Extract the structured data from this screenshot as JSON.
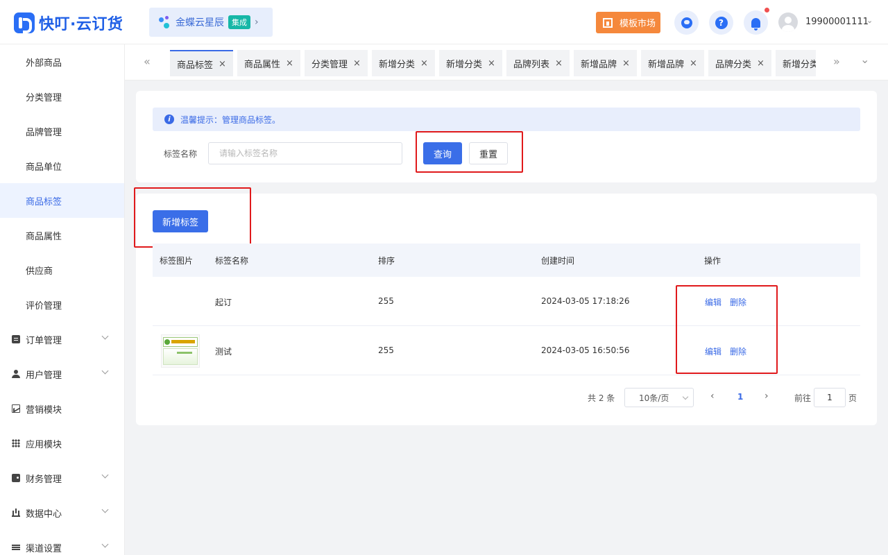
{
  "header": {
    "logo_text": "快叮·云订货",
    "integration": {
      "name": "金蝶云星辰",
      "badge": "集成",
      "arrow": "›"
    },
    "template_market": "模板市场",
    "help_glyph": "?",
    "user_phone": "19900001111",
    "user_caret": "⌄"
  },
  "sidebar": {
    "items": [
      {
        "label": "外部商品",
        "active": false
      },
      {
        "label": "分类管理",
        "active": false
      },
      {
        "label": "品牌管理",
        "active": false
      },
      {
        "label": "商品单位",
        "active": false
      },
      {
        "label": "商品标签",
        "active": true
      },
      {
        "label": "商品属性",
        "active": false
      },
      {
        "label": "供应商",
        "active": false
      },
      {
        "label": "评价管理",
        "active": false
      }
    ],
    "groups": [
      {
        "label": "订单管理",
        "icon": "order-icon",
        "expandable": true
      },
      {
        "label": "用户管理",
        "icon": "user-icon",
        "expandable": true
      },
      {
        "label": "营销模块",
        "icon": "marketing-icon",
        "expandable": false
      },
      {
        "label": "应用模块",
        "icon": "apps-icon",
        "expandable": false
      },
      {
        "label": "财务管理",
        "icon": "wallet-icon",
        "expandable": true
      },
      {
        "label": "数据中心",
        "icon": "bar-chart-icon",
        "expandable": true
      },
      {
        "label": "渠道设置",
        "icon": "list-icon",
        "expandable": true
      }
    ]
  },
  "tabs": {
    "nav_left": "«",
    "nav_right": "»",
    "dropdown": "⌄",
    "close_glyph": "×",
    "items": [
      {
        "label": "商品标签",
        "active": true
      },
      {
        "label": "商品属性",
        "active": false
      },
      {
        "label": "分类管理",
        "active": false
      },
      {
        "label": "新增分类",
        "active": false
      },
      {
        "label": "新增分类",
        "active": false
      },
      {
        "label": "品牌列表",
        "active": false
      },
      {
        "label": "新增品牌",
        "active": false
      },
      {
        "label": "新增品牌",
        "active": false
      },
      {
        "label": "品牌分类",
        "active": false
      },
      {
        "label": "新增分类",
        "active": false
      }
    ]
  },
  "search": {
    "tip_icon": "i",
    "tip": "温馨提示：管理商品标签。",
    "label": "标签名称",
    "placeholder": "请输入标签名称",
    "value": "",
    "query_button": "查询",
    "reset_button": "重置"
  },
  "list": {
    "add_button": "新增标签",
    "columns": [
      "标签图片",
      "标签名称",
      "排序",
      "创建时间",
      "操作"
    ],
    "rows": [
      {
        "has_image": false,
        "name": "起订",
        "sort": "255",
        "created": "2024-03-05 17:18:26",
        "edit": "编辑",
        "delete": "删除"
      },
      {
        "has_image": true,
        "name": "测试",
        "sort": "255",
        "created": "2024-03-05 16:50:56",
        "edit": "编辑",
        "delete": "删除"
      }
    ]
  },
  "pagination": {
    "total": "共 2 条",
    "page_size": "10条/页",
    "prev": "‹",
    "next": "›",
    "current_page": "1",
    "goto_label": "前往",
    "goto_value": "1",
    "page_suffix": "页"
  }
}
